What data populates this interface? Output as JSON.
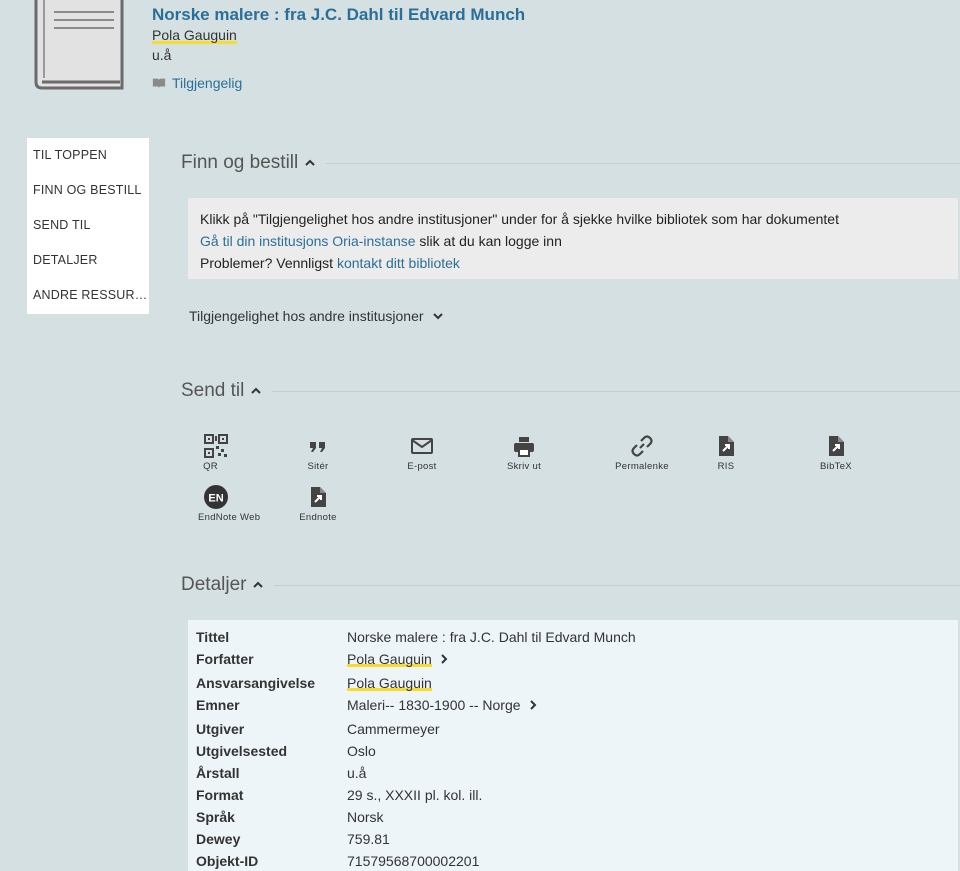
{
  "record": {
    "title": "Norske malere : fra J.C. Dahl til Edvard Munch",
    "author": "Pola Gauguin",
    "date": "u.å",
    "availability": "Tilgjengelig"
  },
  "sidenav": {
    "items": [
      "TIL TOPPEN",
      "FINN OG BESTILL",
      "SEND TIL",
      "DETALJER",
      "ANDRE RESSURSER"
    ]
  },
  "finn": {
    "title": "Finn og bestill",
    "line1": "Klikk på \"Tilgjengelighet hos andre institusjoner\" under for å sjekke hvilke bibliotek som har dokumentet",
    "line2_link": "Gå til din institusjons Oria-instanse",
    "line2_rest": " slik at du kan logge inn",
    "line3_pre": "Problemer? Vennligst ",
    "line3_link": "kontakt ditt bibliotek",
    "other_avail": "Tilgjengelighet hos andre institusjoner"
  },
  "send": {
    "title": "Send til",
    "actions": [
      {
        "label": "QR",
        "icon": "qr-code-icon"
      },
      {
        "label": "Sitér",
        "icon": "quote-icon"
      },
      {
        "label": "E-post",
        "icon": "envelope-icon"
      },
      {
        "label": "Skriv ut",
        "icon": "printer-icon"
      },
      {
        "label": "Permalenke",
        "icon": "link-icon"
      },
      {
        "label": "RIS",
        "icon": "file-export-icon"
      },
      {
        "label": "BibTeX",
        "icon": "file-export-icon"
      },
      {
        "label": "EndNote Web",
        "icon": "endnote-en-icon"
      },
      {
        "label": "Endnote",
        "icon": "file-export-icon"
      }
    ]
  },
  "details": {
    "title": "Detaljer",
    "rows": [
      {
        "label": "Tittel",
        "value": "Norske malere : fra J.C. Dahl til Edvard Munch"
      },
      {
        "label": "Forfatter",
        "value": "Pola Gauguin"
      },
      {
        "label": "Ansvarsangivelse",
        "value": "Pola Gauguin"
      },
      {
        "label": "Emner",
        "value": "Maleri-- 1830-1900 -- Norge"
      },
      {
        "label": "Utgiver",
        "value": "Cammermeyer"
      },
      {
        "label": "Utgivelsested",
        "value": "Oslo"
      },
      {
        "label": "Årstall",
        "value": "u.å"
      },
      {
        "label": "Format",
        "value": "29 s., XXXII pl. kol. ill."
      },
      {
        "label": "Språk",
        "value": "Norsk"
      },
      {
        "label": "Dewey",
        "value": "759.81"
      },
      {
        "label": "Objekt-ID",
        "value": "71579568700002201"
      }
    ]
  },
  "colors": {
    "background": "#d5e0e3",
    "link": "#2b6f98",
    "highlight": "#f7dd2a",
    "details_bg": "#eef5f9",
    "info_bg": "#ececec"
  }
}
